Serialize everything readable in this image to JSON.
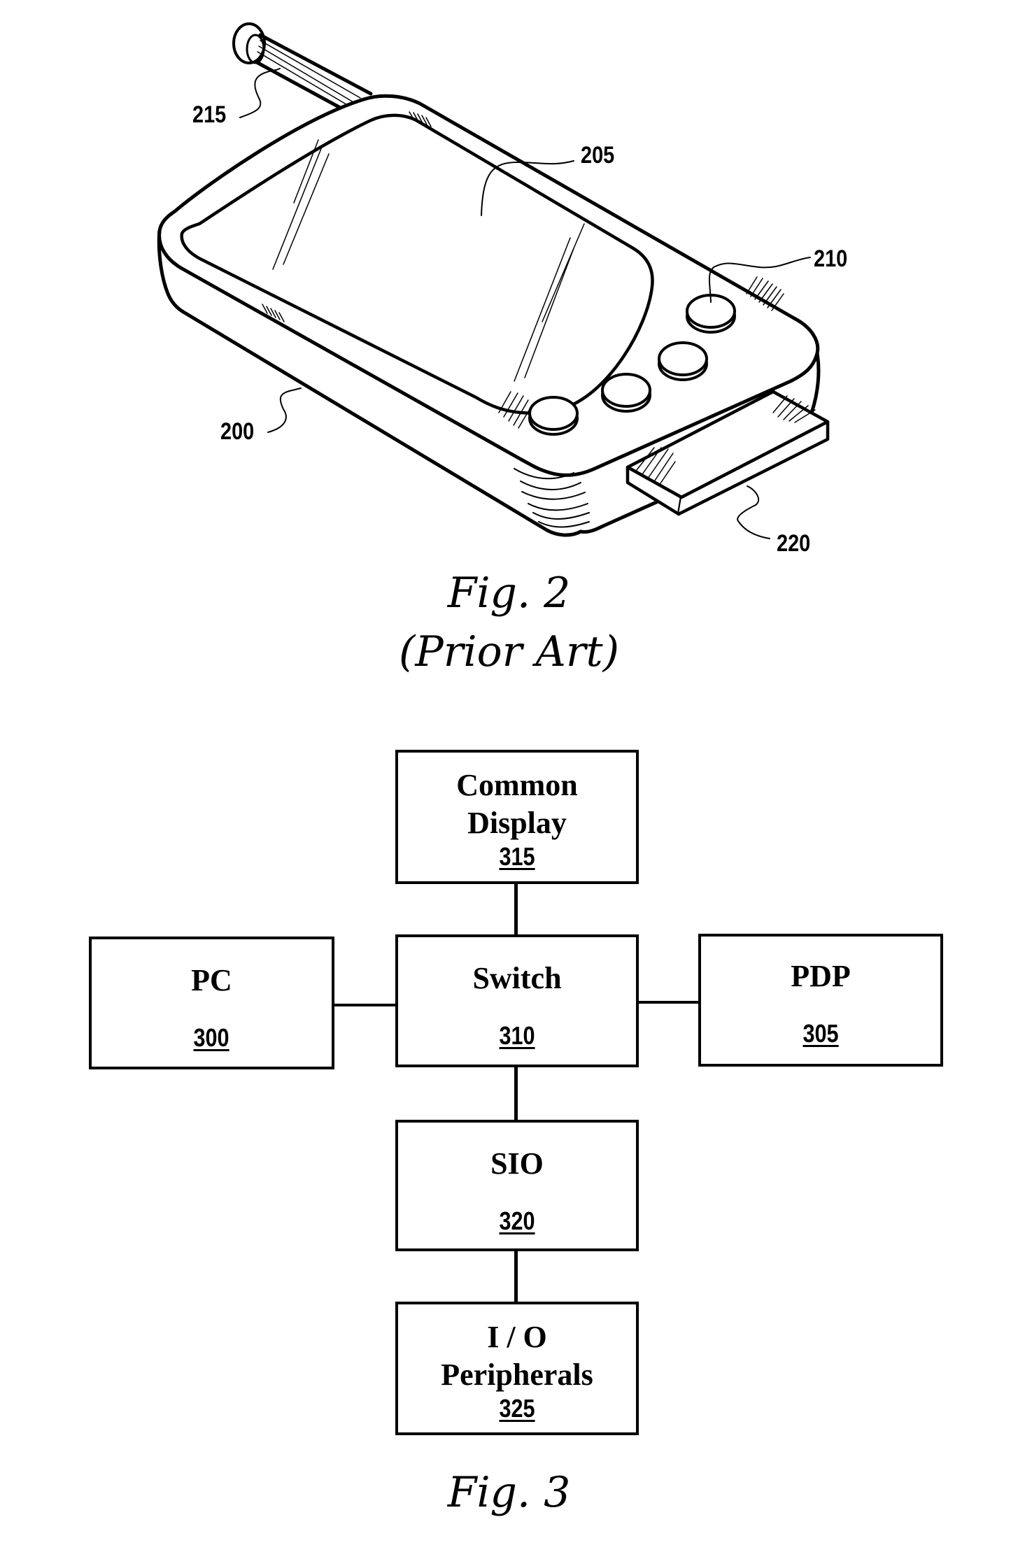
{
  "figure2": {
    "caption_line1": "Fig. 2",
    "caption_line2": "(Prior Art)",
    "labels": {
      "body": "200",
      "screen": "205",
      "button": "210",
      "antenna": "215",
      "card": "220"
    }
  },
  "figure3": {
    "caption": "Fig. 3",
    "blocks": {
      "common_display": {
        "title_line1": "Common",
        "title_line2": "Display",
        "ref": "315"
      },
      "pc": {
        "title": "PC",
        "ref": "300"
      },
      "switch": {
        "title": "Switch",
        "ref": "310"
      },
      "pdp": {
        "title": "PDP",
        "ref": "305"
      },
      "sio": {
        "title": "SIO",
        "ref": "320"
      },
      "io_peripherals": {
        "title_line1": "I / O",
        "title_line2": "Peripherals",
        "ref": "325"
      }
    },
    "connections": [
      [
        "common_display",
        "switch"
      ],
      [
        "pc",
        "switch"
      ],
      [
        "switch",
        "pdp"
      ],
      [
        "switch",
        "sio"
      ],
      [
        "sio",
        "io_peripherals"
      ]
    ]
  }
}
